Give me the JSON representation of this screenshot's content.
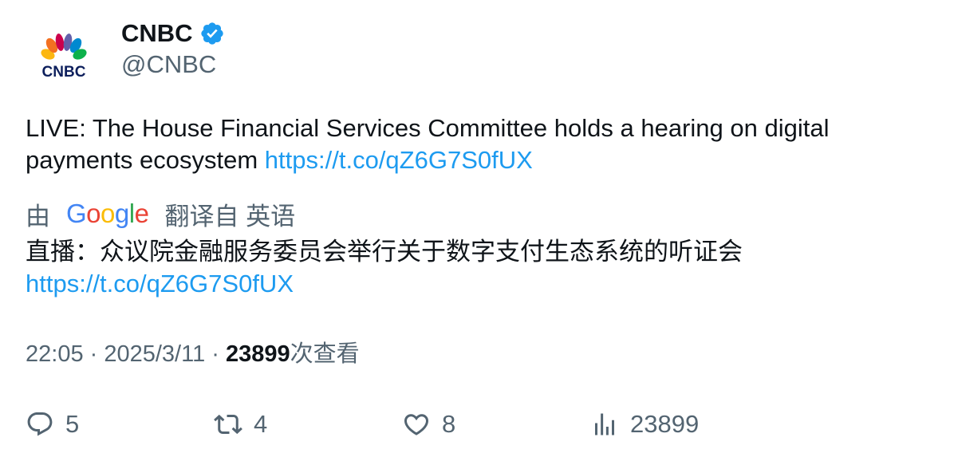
{
  "author": {
    "display_name": "CNBC",
    "handle": "@CNBC",
    "verified": true,
    "avatar_logo_text": "CNBC",
    "verified_badge_color": "#1d9bf0"
  },
  "tweet": {
    "text": "LIVE: The House Financial Services Committee holds a hearing on digital payments ecosystem ",
    "link": "https://t.co/qZ6G7S0fUX"
  },
  "translation": {
    "by_prefix": "由",
    "google_letters": [
      "G",
      "o",
      "o",
      "g",
      "l",
      "e"
    ],
    "translated_from": "翻译自 英语",
    "text": "直播：众议院金融服务委员会举行关于数字支付生态系统的听证会",
    "link": "https://t.co/qZ6G7S0fUX"
  },
  "meta": {
    "time": "22:05",
    "separator": " · ",
    "date": "2025/3/11",
    "views_count": "23899",
    "views_label": "次查看"
  },
  "actions": {
    "reply_count": "5",
    "retweet_count": "4",
    "like_count": "8",
    "views_count": "23899"
  },
  "colors": {
    "link": "#1d9bf0",
    "secondary_text": "#536471",
    "primary_text": "#0f1419"
  }
}
